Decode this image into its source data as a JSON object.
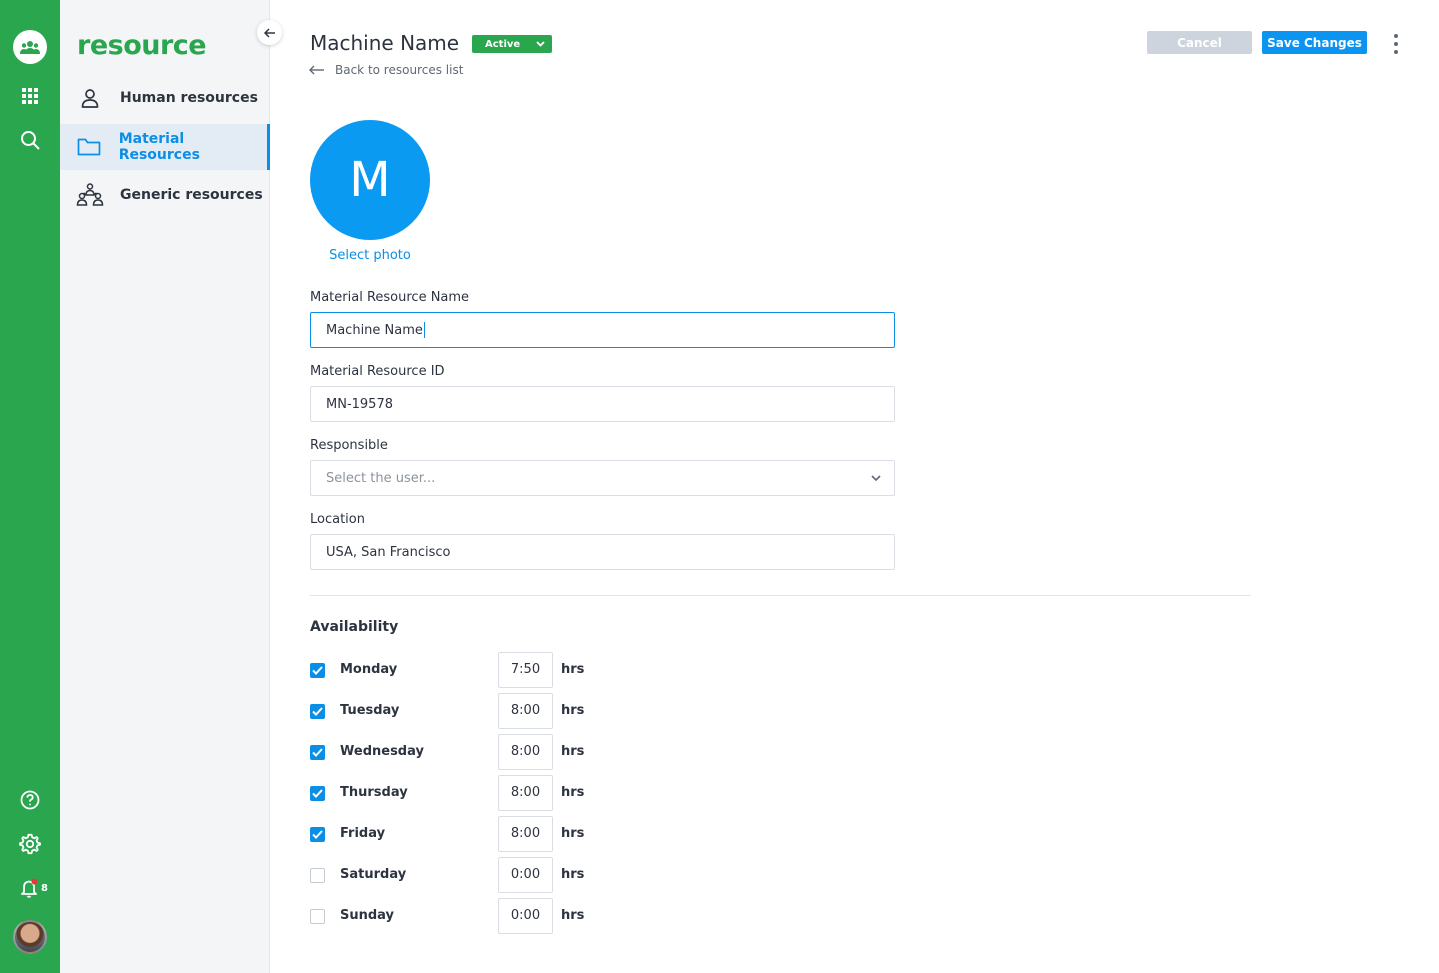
{
  "app": {
    "brand": "resource",
    "notification_count": "8"
  },
  "sidebar": {
    "items": [
      {
        "label": "Human resources",
        "icon": "person-icon",
        "active": false
      },
      {
        "label": "Material Resources",
        "icon": "folder-icon",
        "active": true
      },
      {
        "label": "Generic resources",
        "icon": "group-icon",
        "active": false
      }
    ]
  },
  "header": {
    "title": "Machine Name",
    "status": "Active",
    "back_link": "Back to resources list",
    "cancel_label": "Cancel",
    "save_label": "Save Changes"
  },
  "photo": {
    "initial": "M",
    "select_label": "Select photo"
  },
  "form": {
    "name": {
      "label": "Material Resource Name",
      "value": "Machine Name"
    },
    "id": {
      "label": "Material Resource ID",
      "value": "MN-19578"
    },
    "responsible": {
      "label": "Responsible",
      "placeholder": "Select the user..."
    },
    "location": {
      "label": "Location",
      "value": "USA, San Francisco"
    }
  },
  "availability": {
    "title": "Availability",
    "unit": "hrs",
    "days": [
      {
        "day": "Monday",
        "checked": true,
        "hours": "7:50"
      },
      {
        "day": "Tuesday",
        "checked": true,
        "hours": "8:00"
      },
      {
        "day": "Wednesday",
        "checked": true,
        "hours": "8:00"
      },
      {
        "day": "Thursday",
        "checked": true,
        "hours": "8:00"
      },
      {
        "day": "Friday",
        "checked": true,
        "hours": "8:00"
      },
      {
        "day": "Saturday",
        "checked": false,
        "hours": "0:00"
      },
      {
        "day": "Sunday",
        "checked": false,
        "hours": "0:00"
      }
    ]
  },
  "colors": {
    "brand_green": "#2aa64f",
    "accent_blue": "#0b8fe6",
    "cancel_gray": "#cdd4dd"
  }
}
